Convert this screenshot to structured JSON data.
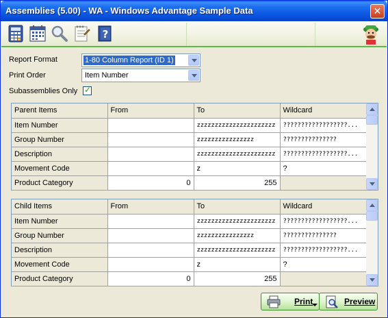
{
  "window": {
    "title": "Assemblies (5.00) - WA - Windows Advantage Sample Data",
    "close_label": "✕"
  },
  "toolbar": {
    "icons": [
      "calculator-icon",
      "calendar-icon",
      "search-icon",
      "notepad-icon",
      "help-icon"
    ],
    "logo": "advantage-mascot-logo"
  },
  "form": {
    "report_format_label": "Report Format",
    "report_format_value": "1-80 Column Report (ID 1)",
    "print_order_label": "Print Order",
    "print_order_value": "Item Number",
    "subassemblies_label": "Subassemblies Only",
    "subassemblies_checked": true
  },
  "parent_grid": {
    "headers": [
      "Parent Items",
      "From",
      "To",
      "Wildcard"
    ],
    "rows": [
      [
        "Item Number",
        "",
        "zzzzzzzzzzzzzzzzzzzzzz",
        "??????????????????..."
      ],
      [
        "Group Number",
        "",
        "zzzzzzzzzzzzzzzz",
        "???????????????"
      ],
      [
        "Description",
        "",
        "zzzzzzzzzzzzzzzzzzzzzz",
        "??????????????????..."
      ],
      [
        "Movement Code",
        "",
        "z",
        "?"
      ],
      [
        "Product Category",
        "0",
        "255",
        ""
      ]
    ]
  },
  "child_grid": {
    "headers": [
      "Child Items",
      "From",
      "To",
      "Wildcard"
    ],
    "rows": [
      [
        "Item Number",
        "",
        "zzzzzzzzzzzzzzzzzzzzzz",
        "??????????????????..."
      ],
      [
        "Group Number",
        "",
        "zzzzzzzzzzzzzzzz",
        "???????????????"
      ],
      [
        "Description",
        "",
        "zzzzzzzzzzzzzzzzzzzzzz",
        "??????????????????..."
      ],
      [
        "Movement Code",
        "",
        "z",
        "?"
      ],
      [
        "Product Category",
        "0",
        "255",
        ""
      ]
    ]
  },
  "buttons": {
    "print_label": "Print",
    "preview_label": "Preview"
  },
  "colors": {
    "title_bar": "#0a55e0",
    "accent_green": "#5cb94a",
    "dialog_bg": "#ece9d8"
  }
}
